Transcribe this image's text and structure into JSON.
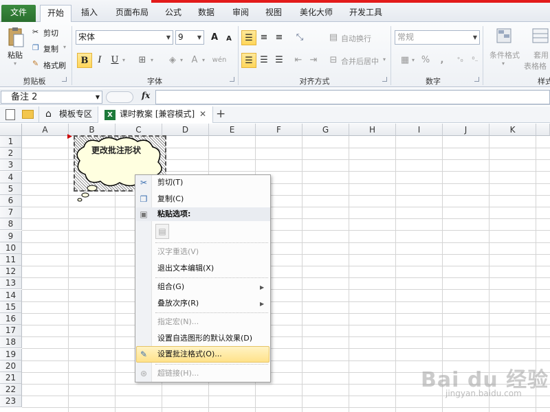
{
  "ribbon_tabs": {
    "file": "文件",
    "home": "开始",
    "insert": "插入",
    "layout": "页面布局",
    "formulas": "公式",
    "data": "数据",
    "review": "审阅",
    "view": "视图",
    "beautify": "美化大师",
    "developer": "开发工具"
  },
  "clipboard": {
    "paste": "粘贴",
    "cut": "剪切",
    "copy": "复制",
    "format_painter": "格式刷",
    "group": "剪贴板"
  },
  "font": {
    "name": "宋体",
    "size": "9",
    "bold": "B",
    "italic": "I",
    "underline": "U",
    "group": "字体",
    "wen": "wén",
    "grow": "A",
    "shrink": "A",
    "color_a": "A"
  },
  "alignment": {
    "wrap": "自动换行",
    "merge": "合并后居中",
    "group": "对齐方式"
  },
  "number": {
    "format": "常规",
    "percent": "%",
    "comma": ",",
    "group": "数字"
  },
  "styles": {
    "conditional": "条件格式",
    "table_fmt_1": "套用",
    "table_fmt_2": "表格格",
    "group": "样式"
  },
  "formula_bar": {
    "name_box": "备注 2",
    "fx": "fx"
  },
  "doc_tabs": {
    "templates": "模板专区",
    "workbook": "课时教案 [兼容模式]",
    "close": "✕",
    "add": "+"
  },
  "columns": [
    "A",
    "B",
    "C",
    "D",
    "E",
    "F",
    "G",
    "H",
    "I",
    "J",
    "K"
  ],
  "rows": [
    "1",
    "2",
    "3",
    "4",
    "5",
    "6",
    "7",
    "8",
    "9",
    "10",
    "11",
    "12",
    "13",
    "14",
    "15",
    "16",
    "17",
    "18",
    "19",
    "20",
    "21",
    "22",
    "23"
  ],
  "comment": {
    "text": "更改批注形状"
  },
  "context_menu": {
    "cut": "剪切(T)",
    "copy": "复制(C)",
    "paste_options": "粘贴选项:",
    "hanzi": "汉字重选(V)",
    "exit_edit": "退出文本编辑(X)",
    "group": "组合(G)",
    "order": "叠放次序(R)",
    "macro": "指定宏(N)...",
    "default_effect": "设置自选图形的默认效果(D)",
    "format_comment": "设置批注格式(O)...",
    "hyperlink": "超链接(H)..."
  },
  "watermark": {
    "brand": "Bai du 经验",
    "url": "jingyan.baidu.com"
  },
  "colors": {
    "accent": "#2a6f2e",
    "highlight": "#ffe28a",
    "red_bar": "#e31b1b"
  }
}
